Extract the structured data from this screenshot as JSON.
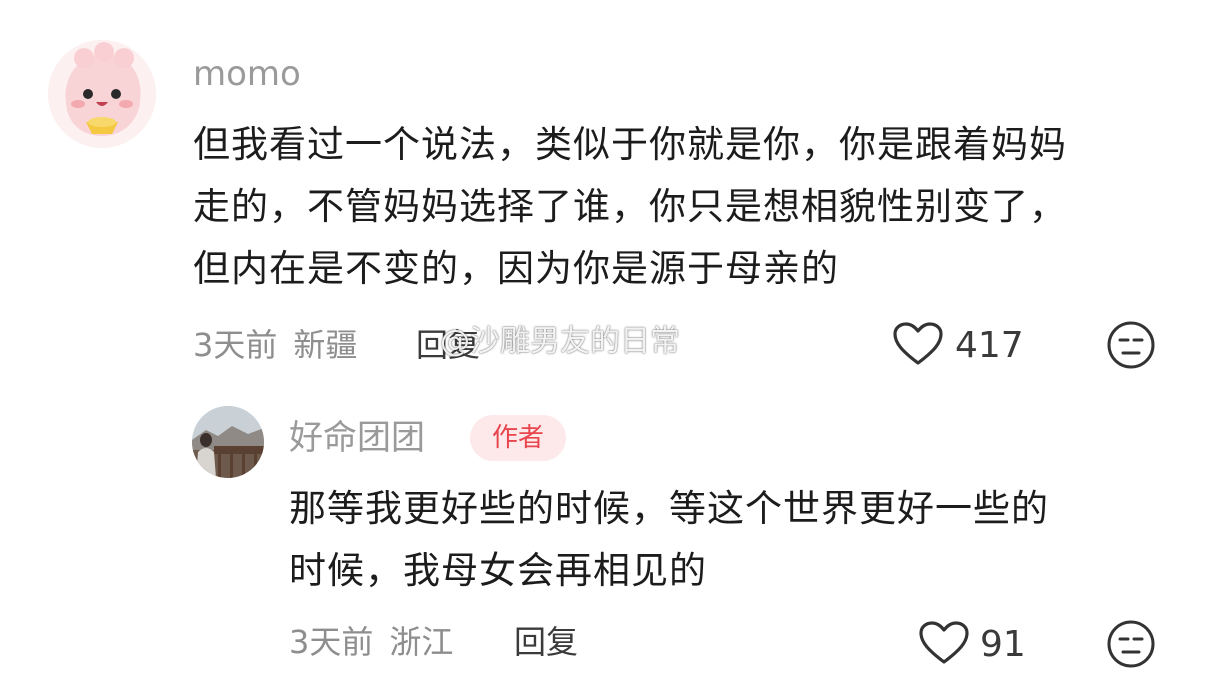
{
  "comment": {
    "username": "momo",
    "lines": [
      "但我看过一个说法，类似于你就是你，你是跟着妈妈",
      "走的，不管妈妈选择了谁，你只是想相貌性别变了，",
      "但内在是不变的，因为你是源于母亲的"
    ],
    "time": "3天前",
    "location": "新疆",
    "reply_label": "回复",
    "like_count": "417",
    "icons": {
      "like": "heart-outline-icon",
      "dislike": "meh-face-icon"
    }
  },
  "watermark": "@沙雕男友的日常",
  "reply": {
    "username": "好命团团",
    "badge": "作者",
    "lines": [
      "那等我更好些的时候，等这个世界更好一些的",
      "时候，我母女会再相见的"
    ],
    "time": "3天前",
    "location": "浙江",
    "reply_label": "回复",
    "like_count": "91"
  },
  "colors": {
    "badge_text": "#e8454d",
    "badge_bg": "#fde8ea",
    "username": "#9a9a9a",
    "body_text": "#1c1c1c"
  }
}
